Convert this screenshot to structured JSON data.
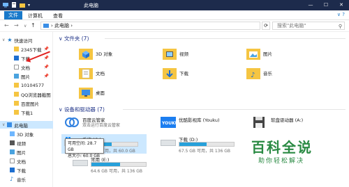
{
  "window": {
    "title": "此电脑",
    "controls": [
      "—",
      "☐",
      "✕"
    ]
  },
  "ribbon": {
    "tabs": [
      "文件",
      "计算机",
      "查看"
    ],
    "help": "∨ ?"
  },
  "address": {
    "path": "此电脑",
    "search_placeholder": "搜索\"此电脑\""
  },
  "sidebar": {
    "items": [
      {
        "label": "快速访问"
      },
      {
        "label": "2345下载"
      },
      {
        "label": "下载"
      },
      {
        "label": "文档"
      },
      {
        "label": "图片"
      },
      {
        "label": "10104577"
      },
      {
        "label": "QQ浏览器截图"
      },
      {
        "label": "百度图片"
      },
      {
        "label": "下载1"
      },
      {
        "label": "此电脑"
      },
      {
        "label": "3D 对象"
      },
      {
        "label": "视频"
      },
      {
        "label": "图片"
      },
      {
        "label": "文档"
      },
      {
        "label": "下载"
      },
      {
        "label": "音乐"
      }
    ]
  },
  "folders_section": {
    "header": "文件夹 (7)",
    "items": [
      {
        "label": "3D 对象"
      },
      {
        "label": "视频"
      },
      {
        "label": "图片"
      },
      {
        "label": "文档"
      },
      {
        "label": "下载"
      },
      {
        "label": "音乐"
      },
      {
        "label": "桌面"
      }
    ]
  },
  "drives_section": {
    "header": "设备和驱动器 (7)",
    "items": [
      {
        "name": "百度云管家",
        "sub": "双击运行百度云管家"
      },
      {
        "name": "优酷影视库 (Youku)"
      },
      {
        "name": "软盘驱动器 (A:)"
      },
      {
        "name": "系统 (C:)",
        "free": "28.7 GB 可用，共 60.0 GB",
        "used_pct": 52
      },
      {
        "name": "下载 (D:)",
        "free": "67.5 GB 可用，共 136 GB",
        "used_pct": 50
      },
      {
        "name": "常用 (E:)",
        "free": "64.6 GB 可用，共 136 GB",
        "used_pct": 52
      }
    ]
  },
  "tooltip": {
    "line1": "可用空间: 28.7 GB",
    "line2": "总大小: 60.0 GB"
  },
  "watermark": {
    "title": "百科全说",
    "subtitle": "助你轻松解决"
  }
}
